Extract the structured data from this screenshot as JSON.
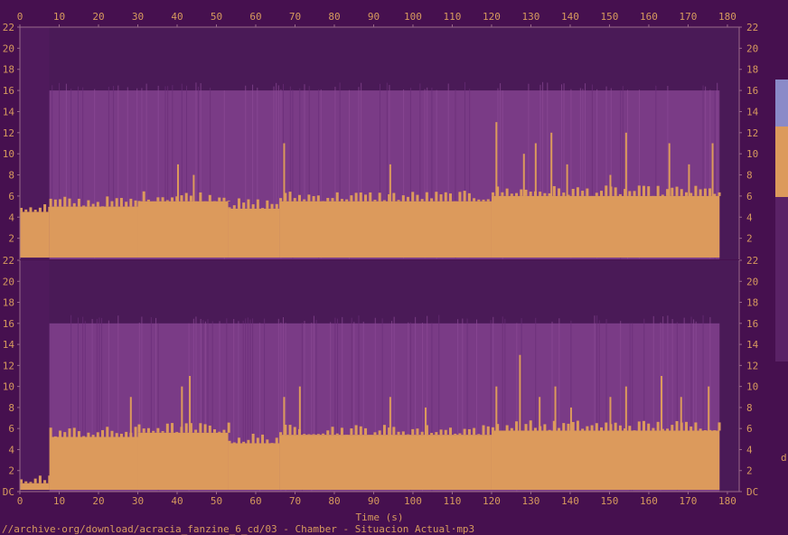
{
  "chart_data": {
    "type": "heatmap",
    "title": "",
    "xlabel": "Time (s)",
    "ylabel": "",
    "xlim": [
      0,
      183
    ],
    "ylim": [
      0,
      22
    ],
    "x_ticks": [
      0,
      10,
      20,
      30,
      40,
      50,
      60,
      70,
      80,
      90,
      100,
      110,
      120,
      130,
      140,
      150,
      160,
      170,
      180
    ],
    "y_tick_labels_top": [
      "22",
      "20",
      "18",
      "16",
      "14",
      "12",
      "10",
      "8",
      "6",
      "4",
      "2"
    ],
    "y_tick_labels_bottom": [
      "22",
      "20",
      "18",
      "16",
      "14",
      "12",
      "10",
      "8",
      "6",
      "4",
      "2",
      "DC"
    ],
    "colorbar_label_partial": "d",
    "file_caption": "//archive·org/download/acracia_fanzine_6_cd/03 - Chamber - Situacion Actual·mp3",
    "colors": {
      "background": "#46104f",
      "loud": "#dc9a5c",
      "mid": "#7a3b86",
      "quiet": "#5a2266",
      "cutoff": "#4a1a57",
      "text": "#d79a5e",
      "axis": "#9a6a8a",
      "peak": "#c3c6e6"
    },
    "channels": [
      {
        "name": "",
        "cutoff_khz": 16,
        "content_start_s": 7.5,
        "content_end_s": 178,
        "segments": [
          {
            "t_start": 0,
            "t_end": 7.5,
            "loud_top_khz": 4.5
          },
          {
            "t_start": 7.5,
            "t_end": 30,
            "loud_top_khz": 5.0
          },
          {
            "t_start": 30,
            "t_end": 53,
            "loud_top_khz": 5.5
          },
          {
            "t_start": 53,
            "t_end": 66,
            "loud_top_khz": 4.8
          },
          {
            "t_start": 66,
            "t_end": 120,
            "loud_top_khz": 5.5
          },
          {
            "t_start": 120,
            "t_end": 178,
            "loud_top_khz": 6.0
          }
        ],
        "peaks": [
          {
            "t": 40,
            "khz": 9
          },
          {
            "t": 44,
            "khz": 8
          },
          {
            "t": 67,
            "khz": 11
          },
          {
            "t": 94,
            "khz": 9
          },
          {
            "t": 121,
            "khz": 13
          },
          {
            "t": 128,
            "khz": 10
          },
          {
            "t": 131,
            "khz": 11
          },
          {
            "t": 135,
            "khz": 12
          },
          {
            "t": 139,
            "khz": 9
          },
          {
            "t": 150,
            "khz": 8
          },
          {
            "t": 154,
            "khz": 12
          },
          {
            "t": 165,
            "khz": 11
          },
          {
            "t": 170,
            "khz": 9
          },
          {
            "t": 176,
            "khz": 11
          }
        ]
      },
      {
        "name": "",
        "cutoff_khz": 16,
        "content_start_s": 7.5,
        "content_end_s": 178,
        "segments": [
          {
            "t_start": 0,
            "t_end": 7.5,
            "loud_top_khz": 0.8
          },
          {
            "t_start": 7.5,
            "t_end": 30,
            "loud_top_khz": 5.2
          },
          {
            "t_start": 30,
            "t_end": 53,
            "loud_top_khz": 5.6
          },
          {
            "t_start": 53,
            "t_end": 66,
            "loud_top_khz": 4.6
          },
          {
            "t_start": 66,
            "t_end": 120,
            "loud_top_khz": 5.4
          },
          {
            "t_start": 120,
            "t_end": 178,
            "loud_top_khz": 5.8
          }
        ],
        "peaks": [
          {
            "t": 28,
            "khz": 9
          },
          {
            "t": 41,
            "khz": 10
          },
          {
            "t": 43,
            "khz": 11
          },
          {
            "t": 67,
            "khz": 9
          },
          {
            "t": 71,
            "khz": 10
          },
          {
            "t": 94,
            "khz": 9
          },
          {
            "t": 103,
            "khz": 8
          },
          {
            "t": 121,
            "khz": 10
          },
          {
            "t": 127,
            "khz": 13
          },
          {
            "t": 132,
            "khz": 9
          },
          {
            "t": 136,
            "khz": 10
          },
          {
            "t": 140,
            "khz": 8
          },
          {
            "t": 150,
            "khz": 9
          },
          {
            "t": 154,
            "khz": 10
          },
          {
            "t": 163,
            "khz": 11
          },
          {
            "t": 168,
            "khz": 9
          },
          {
            "t": 175,
            "khz": 10
          }
        ]
      }
    ]
  }
}
